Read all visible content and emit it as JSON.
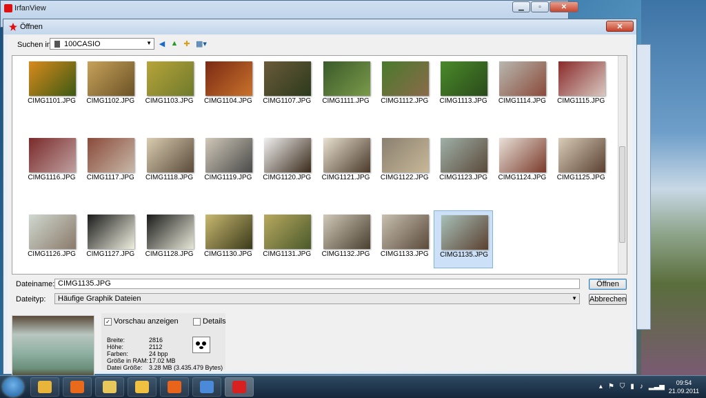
{
  "back_window": {
    "title": "IrfanView"
  },
  "dialog": {
    "title": "Öffnen",
    "look_in_label": "Suchen in:",
    "look_in_value": "100CASIO",
    "filename_label": "Dateiname:",
    "filename_value": "CIMG1135.JPG",
    "filetype_label": "Dateityp:",
    "filetype_value": "Häufige Graphik Dateien",
    "open_button": "Öffnen",
    "cancel_button": "Abbrechen",
    "preview_checkbox": "Vorschau anzeigen",
    "preview_checked": true,
    "details_checkbox": "Details",
    "details_checked": false,
    "info": [
      {
        "key": "Breite:",
        "value": "2816"
      },
      {
        "key": "Höhe:",
        "value": "2112"
      },
      {
        "key": "Farben:",
        "value": "24 bpp"
      },
      {
        "key": "Größe in RAM:",
        "value": "17.02 MB"
      },
      {
        "key": "Datei Größe:",
        "value": "3.28 MB (3.435.479 Bytes)"
      }
    ]
  },
  "files": [
    {
      "name": "CIMG1101.JPG",
      "c1": "#d98a1c",
      "c2": "#3c5a14"
    },
    {
      "name": "CIMG1102.JPG",
      "c1": "#c7a25a",
      "c2": "#6b5226"
    },
    {
      "name": "CIMG1103.JPG",
      "c1": "#b8a43a",
      "c2": "#6e7a2c"
    },
    {
      "name": "CIMG1104.JPG",
      "c1": "#7a2a14",
      "c2": "#c9722c"
    },
    {
      "name": "CIMG1107.JPG",
      "c1": "#6a5a3a",
      "c2": "#2c3a1c"
    },
    {
      "name": "CIMG1111.JPG",
      "c1": "#3a5a2a",
      "c2": "#7a9a4a"
    },
    {
      "name": "CIMG1112.JPG",
      "c1": "#4a7a2c",
      "c2": "#8a6a4a"
    },
    {
      "name": "CIMG1113.JPG",
      "c1": "#4a8a2a",
      "c2": "#2a4a1a"
    },
    {
      "name": "CIMG1114.JPG",
      "c1": "#b8b8b0",
      "c2": "#8a4a3a"
    },
    {
      "name": "CIMG1115.JPG",
      "c1": "#8a2a2a",
      "c2": "#d8c8c0"
    },
    {
      "name": "CIMG1116.JPG",
      "c1": "#7a2a2a",
      "c2": "#c0a0a0"
    },
    {
      "name": "CIMG1117.JPG",
      "c1": "#8a4a3a",
      "c2": "#c8b8a8"
    },
    {
      "name": "CIMG1118.JPG",
      "c1": "#d8ccb0",
      "c2": "#5a4a3a"
    },
    {
      "name": "CIMG1119.JPG",
      "c1": "#d0c8b8",
      "c2": "#4a4a4a"
    },
    {
      "name": "CIMG1120.JPG",
      "c1": "#f0f0f0",
      "c2": "#3a2a1a"
    },
    {
      "name": "CIMG1121.JPG",
      "c1": "#e8e0d0",
      "c2": "#4a3a2a"
    },
    {
      "name": "CIMG1122.JPG",
      "c1": "#8a8070",
      "c2": "#c8b898"
    },
    {
      "name": "CIMG1123.JPG",
      "c1": "#a0b0a8",
      "c2": "#5a4a3a"
    },
    {
      "name": "CIMG1124.JPG",
      "c1": "#e8e0d8",
      "c2": "#7a3a2a"
    },
    {
      "name": "CIMG1125.JPG",
      "c1": "#d8ccb8",
      "c2": "#5a4030"
    },
    {
      "name": "CIMG1126.JPG",
      "c1": "#d0d8d0",
      "c2": "#8a7a6a"
    },
    {
      "name": "CIMG1127.JPG",
      "c1": "#1a1a1a",
      "c2": "#f0f0e0"
    },
    {
      "name": "CIMG1128.JPG",
      "c1": "#1a1a1a",
      "c2": "#e8e8d8"
    },
    {
      "name": "CIMG1130.JPG",
      "c1": "#c8b870",
      "c2": "#3a3a1a"
    },
    {
      "name": "CIMG1131.JPG",
      "c1": "#b8a860",
      "c2": "#4a5a2a"
    },
    {
      "name": "CIMG1132.JPG",
      "c1": "#d0c8b8",
      "c2": "#4a4030"
    },
    {
      "name": "CIMG1133.JPG",
      "c1": "#c8c0b0",
      "c2": "#5a4a3a"
    },
    {
      "name": "CIMG1135.JPG",
      "c1": "#a8c0b8",
      "c2": "#5a4030",
      "selected": true
    }
  ],
  "taskbar": {
    "apps": [
      {
        "icon": "folder-icon",
        "color": "#e8b43a"
      },
      {
        "icon": "media-player-icon",
        "color": "#e86a1a"
      },
      {
        "icon": "tool-icon",
        "color": "#e8c85a"
      },
      {
        "icon": "mail-icon",
        "color": "#f0c040"
      },
      {
        "icon": "firefox-icon",
        "color": "#e8641a"
      },
      {
        "icon": "window-icon",
        "color": "#4a8ad8"
      },
      {
        "icon": "irfanview-icon",
        "color": "#d82020",
        "active": true
      }
    ],
    "time": "09:54",
    "date": "21.09.2011"
  }
}
